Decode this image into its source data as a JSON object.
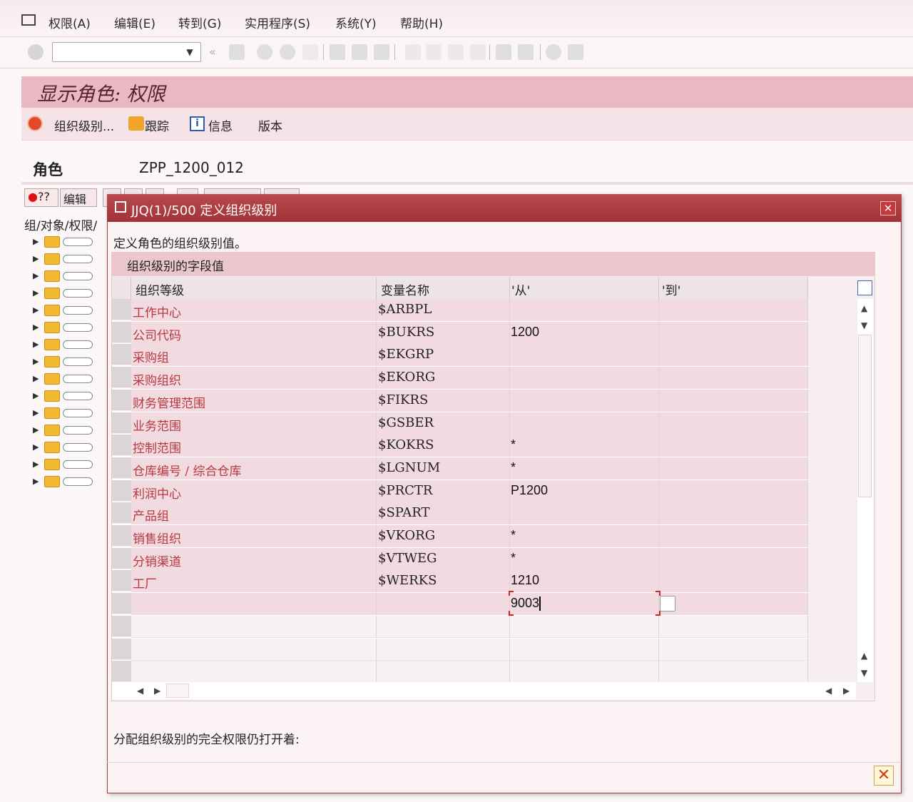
{
  "menu": {
    "items": [
      "权限(A)",
      "编辑(E)",
      "转到(G)",
      "实用程序(S)",
      "系统(Y)",
      "帮助(H)"
    ]
  },
  "screen": {
    "title": "显示角色: 权限",
    "toolbar": {
      "org_levels": "组织级别...",
      "trace": "跟踪",
      "info": "信息",
      "version": "版本"
    },
    "role_label": "角色",
    "role_value": "ZPP_1200_012",
    "edit_btn": "编辑",
    "tree_header": "组/对象/权限/"
  },
  "dialog": {
    "title": "JJQ(1)/500 定义组织级别",
    "description": "定义角色的组织级别值。",
    "group_title": "组织级别的字段值",
    "columns": [
      "组织等级",
      "变量名称",
      "'从'",
      "'到'"
    ],
    "rows": [
      {
        "name": "工作中心",
        "var": "$ARBPL",
        "from": "",
        "to": ""
      },
      {
        "name": "公司代码",
        "var": "$BUKRS",
        "from": "1200",
        "to": ""
      },
      {
        "name": "采购组",
        "var": "$EKGRP",
        "from": "",
        "to": ""
      },
      {
        "name": "采购组织",
        "var": "$EKORG",
        "from": "",
        "to": ""
      },
      {
        "name": "财务管理范围",
        "var": "$FIKRS",
        "from": "",
        "to": ""
      },
      {
        "name": "业务范围",
        "var": "$GSBER",
        "from": "",
        "to": ""
      },
      {
        "name": "控制范围",
        "var": "$KOKRS",
        "from": "*",
        "to": ""
      },
      {
        "name": "仓库编号 / 综合仓库",
        "var": "$LGNUM",
        "from": "*",
        "to": ""
      },
      {
        "name": "利润中心",
        "var": "$PRCTR",
        "from": "P1200",
        "to": ""
      },
      {
        "name": "产品组",
        "var": "$SPART",
        "from": "",
        "to": ""
      },
      {
        "name": "销售组织",
        "var": "$VKORG",
        "from": "*",
        "to": ""
      },
      {
        "name": "分销渠道",
        "var": "$VTWEG",
        "from": "*",
        "to": ""
      },
      {
        "name": "工厂",
        "var": "$WERKS",
        "from": "1210",
        "to": ""
      },
      {
        "name": "",
        "var": "",
        "from": "9003",
        "to": ""
      }
    ],
    "footer": "分配组织级别的完全权限仍打开着:"
  }
}
